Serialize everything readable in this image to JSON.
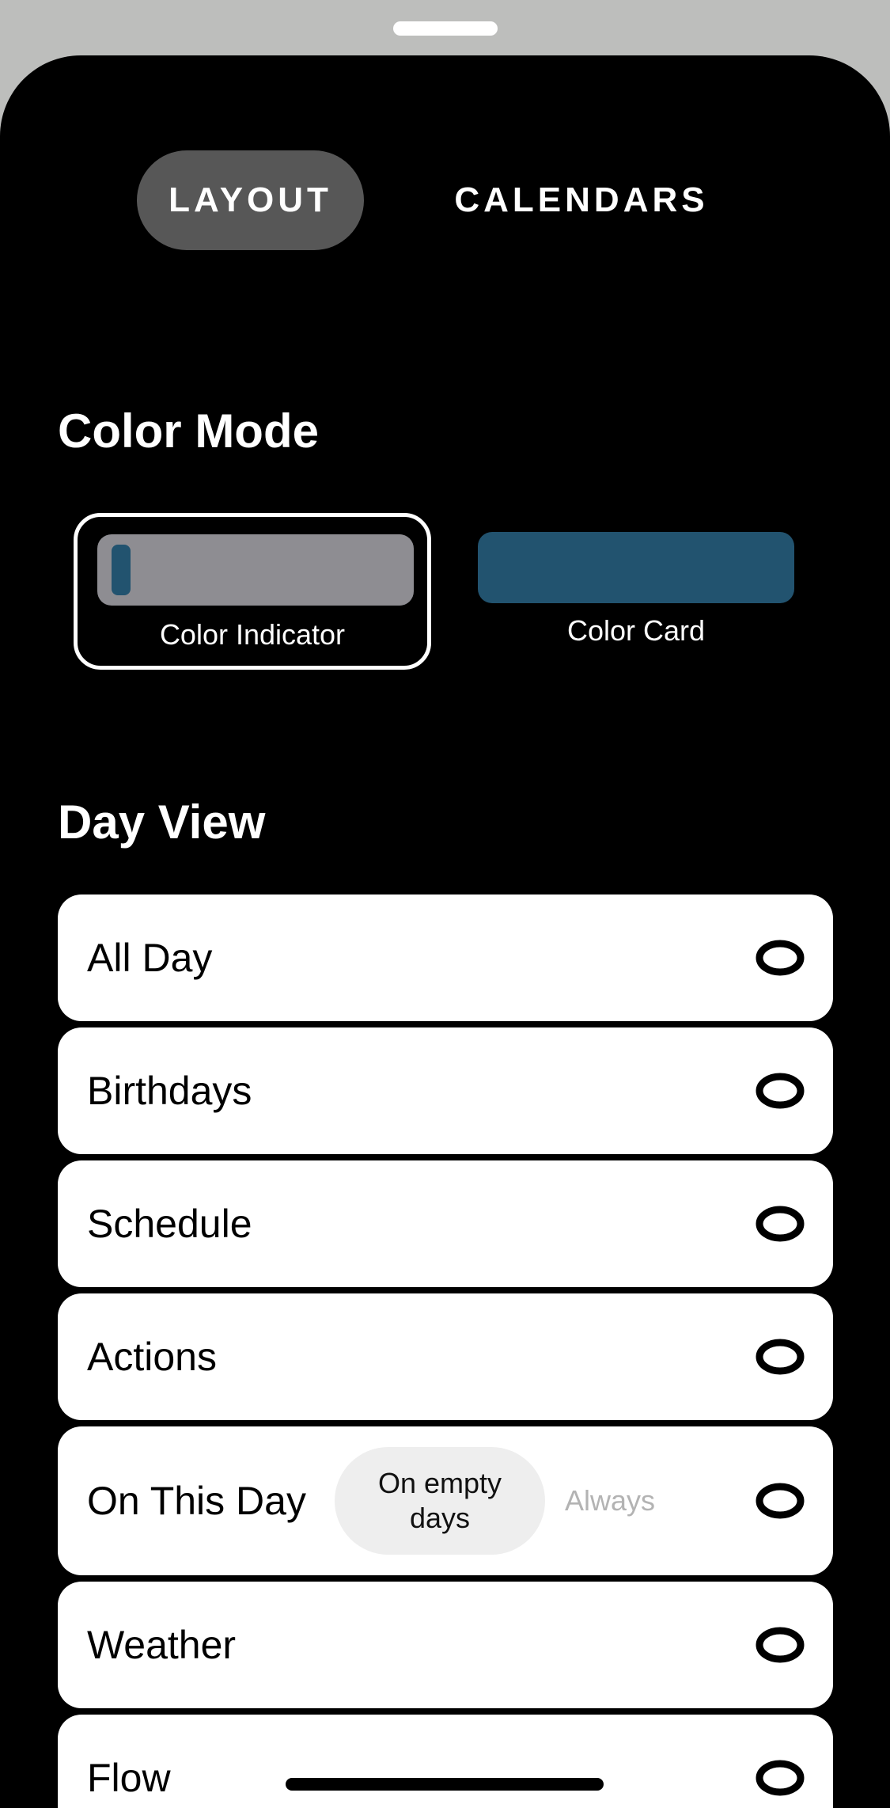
{
  "tabs": [
    {
      "label": "LAYOUT",
      "active": true
    },
    {
      "label": "CALENDARS",
      "active": false
    }
  ],
  "color_mode": {
    "title": "Color Mode",
    "options": [
      {
        "label": "Color Indicator",
        "selected": true
      },
      {
        "label": "Color Card",
        "selected": false
      }
    ],
    "accent_color": "#22536f",
    "indicator_bg": "#8e8d92"
  },
  "day_view": {
    "title": "Day View",
    "rows": [
      {
        "label": "All Day",
        "icon": "eye-icon"
      },
      {
        "label": "Birthdays",
        "icon": "eye-icon"
      },
      {
        "label": "Schedule",
        "icon": "eye-icon"
      },
      {
        "label": "Actions",
        "icon": "eye-icon"
      },
      {
        "label": "On This Day",
        "icon": "eye-icon",
        "segments": [
          "On empty days",
          "Always"
        ],
        "selected_segment": "On empty days"
      },
      {
        "label": "Weather",
        "icon": "eye-icon"
      },
      {
        "label": "Flow",
        "icon": "eye-icon"
      }
    ]
  }
}
